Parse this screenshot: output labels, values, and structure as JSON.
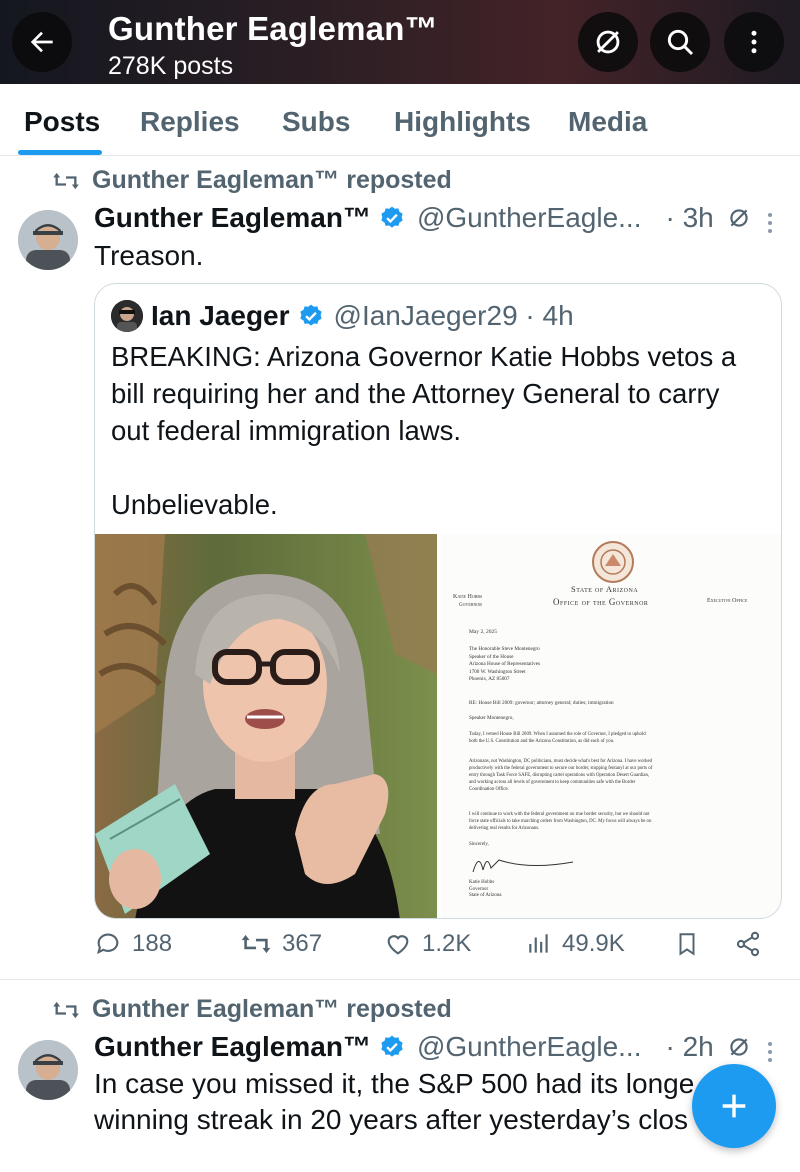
{
  "header": {
    "name": "Gunther Eagleman™",
    "post_count": "278K posts"
  },
  "tabs": [
    "Posts",
    "Replies",
    "Subs",
    "Highlights",
    "Media"
  ],
  "posts": [
    {
      "repost_label": "Gunther Eagleman™ reposted",
      "name": "Gunther Eagleman™",
      "handle": "@GuntherEagle...",
      "time": "· 3h",
      "text": "Treason.",
      "quote": {
        "name": "Ian Jaeger",
        "handle": "@IanJaeger29 · 4h",
        "lines": [
          "BREAKING: Arizona Governor Katie Hobbs vetos a",
          "bill requiring her and the Attorney General to carry",
          "out federal immigration laws.",
          "",
          "Unbelievable."
        ],
        "doc": {
          "state": "State of Arizona",
          "office": "Office of the Governor",
          "left": "Katie Hobbs",
          "left_sub": "Governor",
          "right": "Executive Office",
          "date": "May 2, 2025",
          "addr": [
            "The Honorable Steve Montenegro",
            "Speaker of the House",
            "Arizona House of Representatives",
            "1700 W. Washington Street",
            "Phoenix, AZ 85007"
          ],
          "re": "RE: House Bill 2009: governor; attorney general; duties; immigration",
          "salutation": "Speaker Montenegro,",
          "p1": [
            "Today, I vetoed House Bill 2009. When I assumed the role of Governor, I pledged to uphold",
            "both the U.S. Constitution and the Arizona Constitution, as did each of you."
          ],
          "p2": [
            "Arizonans, not Washington, DC politicians, must decide what's best for Arizona. I have worked",
            "productively with the federal government to secure our border, stopping fentanyl at our ports of",
            "entry through Task Force SAFE, disrupting cartel operations with Operation Desert Guardian,",
            "and working across all levels of government to keep communities safe with the Border",
            "Coordination Office."
          ],
          "p3": [
            "I will continue to work with the federal government on true border security, but we should not",
            "force state officials to take marching orders from Washington, DC. My focus will always be on",
            "delivering real results for Arizonans."
          ],
          "closing": "Sincerely,",
          "sig_lines": [
            "Katie Hobbs",
            "Governor",
            "State of Arizona"
          ]
        }
      },
      "stats": {
        "replies": "188",
        "reposts": "367",
        "likes": "1.2K",
        "views": "49.9K"
      }
    },
    {
      "repost_label": "Gunther Eagleman™ reposted",
      "name": "Gunther Eagleman™",
      "handle": "@GuntherEagle...",
      "time": "· 2h",
      "text_lines": [
        "In case you missed it, the S&P 500 had its longe",
        "winning streak in 20 years after yesterday’s clos"
      ]
    }
  ],
  "colors": {
    "accent": "#1d9bf0",
    "text": "#0f1419",
    "secondary": "#536471",
    "verified": "#1d9bf0"
  },
  "icons": [
    "back-arrow-icon",
    "notifications-off-icon",
    "search-icon",
    "more-vertical-icon",
    "repost-icon",
    "verified-badge-icon",
    "reply-icon",
    "like-icon",
    "views-icon",
    "bookmark-icon",
    "share-icon",
    "plus-icon"
  ]
}
